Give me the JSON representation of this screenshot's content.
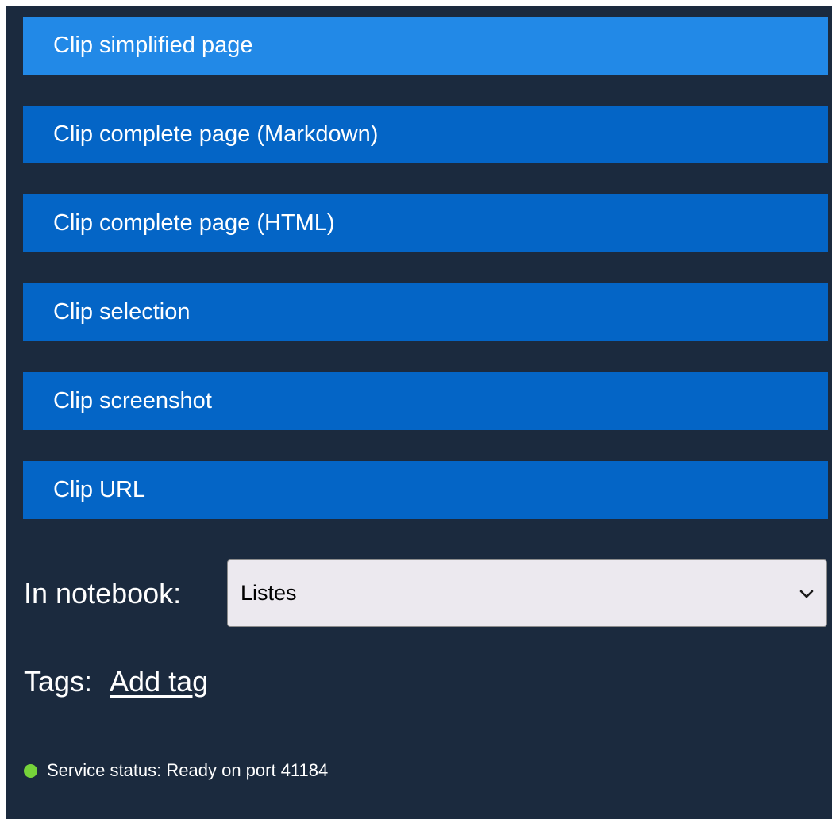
{
  "clip_buttons": [
    {
      "label": "Clip simplified page"
    },
    {
      "label": "Clip complete page (Markdown)"
    },
    {
      "label": "Clip complete page (HTML)"
    },
    {
      "label": "Clip selection"
    },
    {
      "label": "Clip screenshot"
    },
    {
      "label": "Clip URL"
    }
  ],
  "notebook": {
    "label": "In notebook:",
    "selected": "Listes",
    "icon": "chevron-down-icon"
  },
  "tags": {
    "label": "Tags:",
    "add_link": "Add tag"
  },
  "status": {
    "text": "Service status: Ready on port 41184",
    "indicator_color": "#76d33a"
  },
  "colors": {
    "panel_background": "#1b2a3e",
    "primary_button": "#2289e7",
    "secondary_button": "#0465c6",
    "select_background": "#ece9ef"
  }
}
